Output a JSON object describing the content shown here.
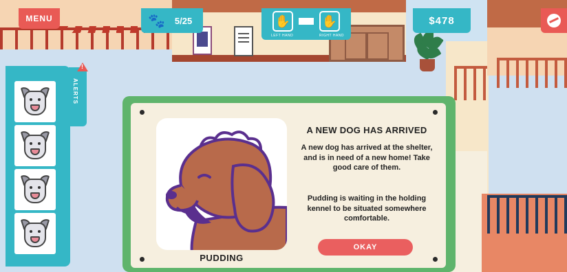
{
  "hud": {
    "menu_label": "MENU",
    "paw_icon": "paw-icon",
    "dog_count": "5/25",
    "left_hand_label": "LEFT HAND",
    "right_hand_label": "RIGHT HAND",
    "money": "$478",
    "tool_icon": "pen-tool-icon"
  },
  "alerts": {
    "tab_label": "ALERTS",
    "items": [
      {
        "icon": "dog-face-icon"
      },
      {
        "icon": "dog-face-icon"
      },
      {
        "icon": "dog-face-icon"
      },
      {
        "icon": "dog-face-icon"
      }
    ]
  },
  "modal": {
    "title": "A NEW DOG HAS ARRIVED",
    "body1": "A new dog has arrived at the shelter, and is in need of a new home! Take good care of them.",
    "body2": "Pudding is waiting in the holding kennel to be situated somewhere comfortable.",
    "dog_name": "PUDDING",
    "okay_label": "OKAY"
  },
  "colors": {
    "accent_teal": "#35b7c6",
    "accent_red": "#e95a55",
    "modal_green": "#5fb46c",
    "dog_brown": "#b86a4b",
    "dog_outline": "#5a2f8e"
  }
}
